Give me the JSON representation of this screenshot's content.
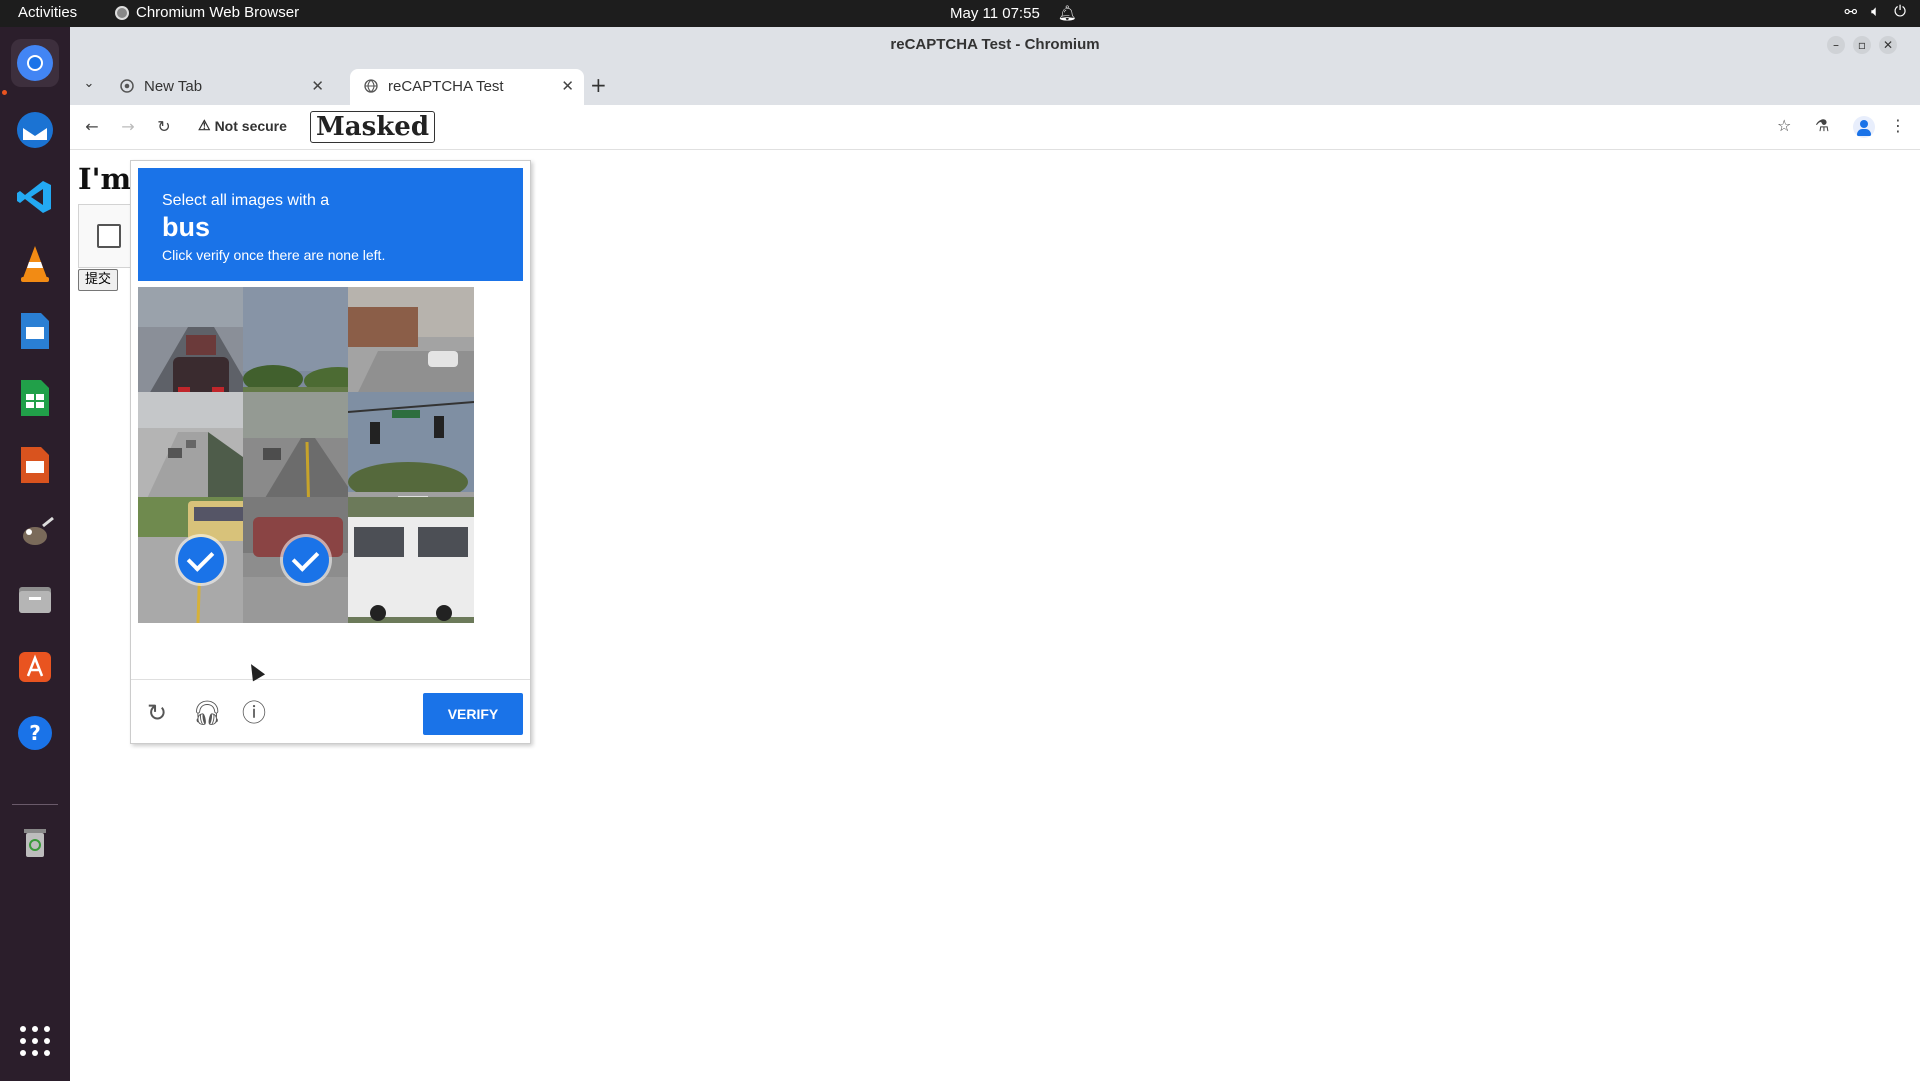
{
  "topbar": {
    "activities": "Activities",
    "app_name": "Chromium Web Browser",
    "clock": "May 11  07:55"
  },
  "dock": {
    "items": [
      "chromium-icon",
      "thunderbird-icon",
      "vscode-icon",
      "vlc-icon",
      "writer-icon",
      "calc-icon",
      "impress-icon",
      "gimp-icon",
      "files-icon",
      "software-icon",
      "help-icon",
      "trash-icon",
      "app-grid-icon"
    ]
  },
  "window": {
    "title": "reCAPTCHA Test - Chromium"
  },
  "tabs": [
    {
      "label": "New Tab"
    },
    {
      "label": "reCAPTCHA Test"
    }
  ],
  "toolbar": {
    "security_label": "Not secure",
    "url_masked": "Masked"
  },
  "page": {
    "heading": "I'm",
    "submit_label": "提交"
  },
  "captcha": {
    "instruction": "Select all images with a",
    "target": "bus",
    "subtext": "Click verify once there are none left.",
    "verify_label": "VERIFY",
    "tiles": [
      {
        "selected": false,
        "scene": "traffic-jam"
      },
      {
        "selected": false,
        "scene": "grass-trees"
      },
      {
        "selected": false,
        "scene": "street-car"
      },
      {
        "selected": false,
        "scene": "highway"
      },
      {
        "selected": false,
        "scene": "road"
      },
      {
        "selected": false,
        "scene": "traffic-lights"
      },
      {
        "selected": true,
        "scene": "bus-yellow"
      },
      {
        "selected": true,
        "scene": "car-street"
      },
      {
        "selected": false,
        "scene": "bus-white"
      }
    ]
  },
  "colors": {
    "accent": "#1a73e8",
    "dock_bg": "#2b1e2b",
    "topbar_bg": "#1d1d1d"
  }
}
